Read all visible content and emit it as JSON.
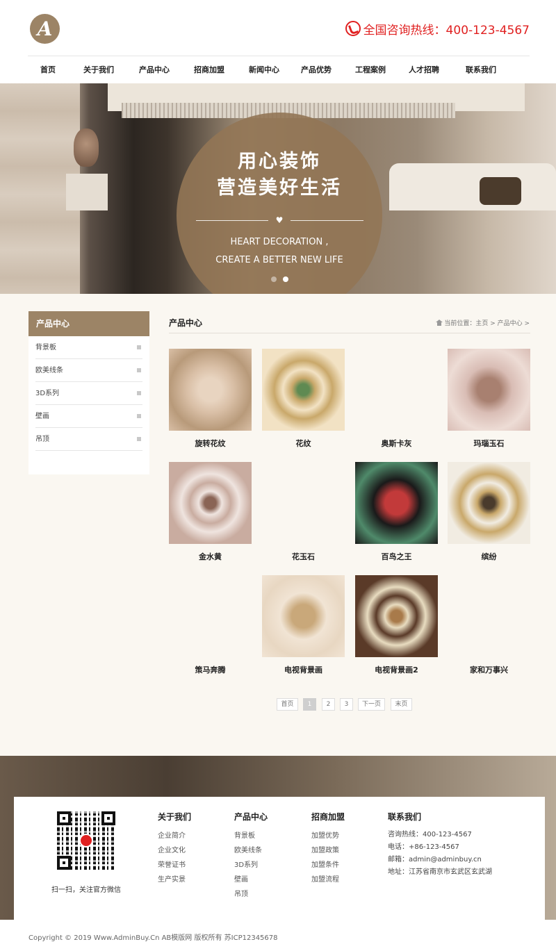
{
  "header": {
    "logo_letter": "A",
    "hotline": "全国咨询热线：400-123-4567"
  },
  "nav": {
    "items": [
      {
        "label": "首页"
      },
      {
        "label": "关于我们"
      },
      {
        "label": "产品中心"
      },
      {
        "label": "招商加盟"
      },
      {
        "label": "新闻中心"
      },
      {
        "label": "产品优势"
      },
      {
        "label": "工程案例"
      },
      {
        "label": "人才招聘"
      },
      {
        "label": "联系我们"
      }
    ]
  },
  "banner": {
    "title_line1": "用心装饰",
    "title_line2": "营造美好生活",
    "sub_line1": "HEART DECORATION ,",
    "sub_line2": "CREATE A BETTER NEW LIFE",
    "slides": 2,
    "active_slide": 2
  },
  "sidebar": {
    "title": "产品中心",
    "items": [
      {
        "label": "背景板"
      },
      {
        "label": "欧美线条"
      },
      {
        "label": "3D系列"
      },
      {
        "label": "壁画"
      },
      {
        "label": "吊顶"
      }
    ]
  },
  "content": {
    "title": "产品中心",
    "breadcrumb": "当前位置：主页 > 产品中心 >"
  },
  "products": [
    {
      "name": "旋转花纹",
      "palette": [
        "#d9bfa6",
        "#e8d4c0",
        "#b89a7a"
      ]
    },
    {
      "name": "花纹",
      "palette": [
        "#f2e2c4",
        "#c9a86a",
        "#5f8a52"
      ]
    },
    {
      "name": "奥斯卡灰",
      "palette": [
        "#e9d6d0",
        "#b89588",
        "#7a5a50"
      ]
    },
    {
      "name": "玛瑙玉石",
      "palette": [
        "#d9bdb5",
        "#a88070",
        "#eddcd5"
      ]
    },
    {
      "name": "金水黄",
      "palette": [
        "#c9aca0",
        "#efe4df",
        "#8a6455"
      ]
    },
    {
      "name": "花玉石",
      "palette": [
        "#c7a58c",
        "#f0e4d8",
        "#8b5a3c"
      ]
    },
    {
      "name": "百鸟之王",
      "palette": [
        "#1a1a1a",
        "#c23a3a",
        "#4f8a6a"
      ]
    },
    {
      "name": "缤纷",
      "palette": [
        "#f1ece2",
        "#c9a86a",
        "#4a3b2c"
      ]
    },
    {
      "name": "策马奔腾",
      "palette": [
        "#9dc07a",
        "#cfe3b2",
        "#5b8a3c"
      ]
    },
    {
      "name": "电视背景画",
      "palette": [
        "#f1e4d4",
        "#c9a87a",
        "#e8d7c2"
      ]
    },
    {
      "name": "电视背景画2",
      "palette": [
        "#5a3a28",
        "#e8dcc0",
        "#a87a4a"
      ]
    },
    {
      "name": "家和万事兴",
      "palette": [
        "#f4f1ee",
        "#d6c8c8",
        "#9a7a8a"
      ]
    }
  ],
  "pagination": {
    "items": [
      {
        "label": "首页",
        "active": false
      },
      {
        "label": "1",
        "active": true
      },
      {
        "label": "2",
        "active": false
      },
      {
        "label": "3",
        "active": false
      },
      {
        "label": "下一页",
        "active": false
      },
      {
        "label": "末页",
        "active": false
      }
    ]
  },
  "footer": {
    "qr_caption": "扫一扫，关注官方微信",
    "col_about": {
      "title": "关于我们",
      "links": [
        "企业简介",
        "企业文化",
        "荣誉证书",
        "生产实景"
      ]
    },
    "col_products": {
      "title": "产品中心",
      "links": [
        "背景板",
        "欧美线条",
        "3D系列",
        "壁画",
        "吊顶"
      ]
    },
    "col_join": {
      "title": "招商加盟",
      "links": [
        "加盟优势",
        "加盟政策",
        "加盟条件",
        "加盟流程"
      ]
    },
    "col_contact": {
      "title": "联系我们",
      "lines": [
        "咨询热线：400-123-4567",
        "电话：+86-123-4567",
        "邮箱：admin@adminbuy.cn",
        "地址：江苏省南京市玄武区玄武湖"
      ]
    },
    "copyright": "Copyright © 2019 Www.AdminBuy.Cn AB模版网 版权所有      苏ICP12345678"
  },
  "colors": {
    "brand": "#9c8466",
    "hotline": "#e02020",
    "background": "#faf7f1"
  }
}
